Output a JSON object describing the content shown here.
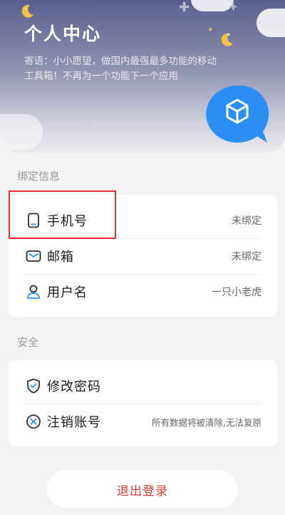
{
  "header": {
    "title": "个人中心",
    "motto": "寄语：小小愿望，做国内最强最多功能的移动工具箱！不再为一个功能下一个应用"
  },
  "sections": {
    "binding": {
      "label": "绑定信息",
      "rows": [
        {
          "label": "手机号",
          "value": "未绑定",
          "icon": "phone-icon"
        },
        {
          "label": "邮箱",
          "value": "未绑定",
          "icon": "mail-icon"
        },
        {
          "label": "用户名",
          "value": "一只小老虎",
          "icon": "user-icon"
        }
      ]
    },
    "security": {
      "label": "安全",
      "rows": [
        {
          "label": "修改密码",
          "value": "",
          "icon": "shield-icon"
        },
        {
          "label": "注销账号",
          "value": "所有数据将被清除,无法复原",
          "icon": "close-circle-icon"
        }
      ]
    }
  },
  "logout_label": "退出登录",
  "colors": {
    "accent": "#2a8ef3",
    "danger": "#d93a34",
    "highlight_box": "#e0322e",
    "background": "#f3f3f5"
  }
}
